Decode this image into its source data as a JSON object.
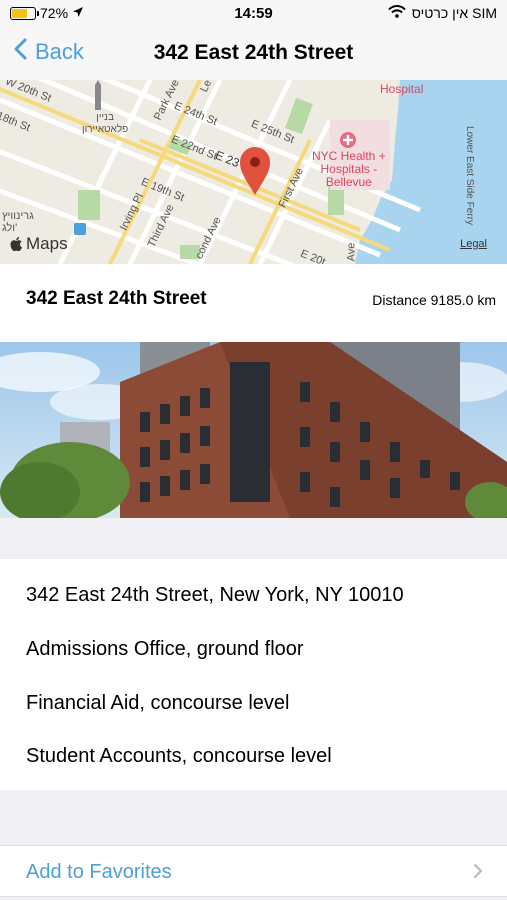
{
  "status_bar": {
    "battery": "72%",
    "battery_level": 0.72,
    "time": "14:59",
    "carrier": "אין כרטיס SIM"
  },
  "nav": {
    "back_label": "Back",
    "title": "342 East 24th Street"
  },
  "map": {
    "logo_text": "Maps",
    "legal": "Legal",
    "hospital_top": "Hospital",
    "hospital_label": [
      "NYC Health +",
      "Hospitals -",
      "Bellevue"
    ],
    "streets": {
      "w20": "W 20th St",
      "e24": "E 24th St",
      "e25": "E 25th St",
      "e22": "E 22nd St",
      "e23": "E 23",
      "e19": "E 19th St",
      "first_ave": "First Ave",
      "third_ave": "Third Ave",
      "second_ave": "cond Ave",
      "irving": "Irving Pl",
      "park": "Park Ave",
      "lex": "Le",
      "fdr": "Lower East Side Ferry",
      "w18": "18th St",
      "flatiron": [
        "בניין",
        "פלאטאיירון"
      ],
      "gramercy": [
        "גרינוויץ",
        "ולג'"
      ],
      "ave": "Ave",
      "e20": "E 20t"
    },
    "pin_color": "#e0513e",
    "water_color": "#a8d4ef"
  },
  "info": {
    "title": "342 East 24th Street",
    "distance": "Distance 9185.0 km"
  },
  "details": [
    "342 East 24th Street, New York, NY 10010",
    "Admissions Office, ground floor",
    "Financial Aid, concourse level",
    "Student Accounts, concourse level"
  ],
  "favorites": {
    "label": "Add to Favorites"
  },
  "colors": {
    "accent": "#4aa0d9",
    "background": "#efeff4"
  }
}
